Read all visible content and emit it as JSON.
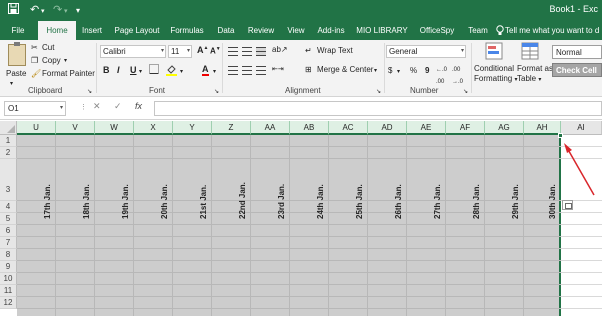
{
  "titlebar": {
    "title": "Book1 - Exc",
    "icons": [
      "save-icon",
      "undo-icon",
      "redo-icon",
      "customize-qat-icon"
    ]
  },
  "tabs": [
    {
      "label": "File",
      "active": false
    },
    {
      "label": "Home",
      "active": true
    },
    {
      "label": "Insert",
      "active": false
    },
    {
      "label": "Page Layout",
      "active": false
    },
    {
      "label": "Formulas",
      "active": false
    },
    {
      "label": "Data",
      "active": false
    },
    {
      "label": "Review",
      "active": false
    },
    {
      "label": "View",
      "active": false
    },
    {
      "label": "Add-ins",
      "active": false
    },
    {
      "label": "MIO LIBRARY",
      "active": false
    },
    {
      "label": "OfficeSpy",
      "active": false
    },
    {
      "label": "Team",
      "active": false
    }
  ],
  "tell_me": "Tell me what you want to d",
  "ribbon": {
    "clipboard": {
      "paste": "Paste",
      "cut": "Cut",
      "copy": "Copy",
      "format_painter": "Format Painter",
      "label": "Clipboard"
    },
    "font": {
      "name": "Calibri",
      "size": "11",
      "grow": "A",
      "shrink": "A",
      "bold": "B",
      "italic": "I",
      "underline": "U",
      "font_color": "A",
      "label": "Font"
    },
    "alignment": {
      "wrap_text": "Wrap Text",
      "merge_center": "Merge & Center",
      "label": "Alignment"
    },
    "number": {
      "format": "General",
      "currency": "$",
      "percent": "%",
      "comma": "9",
      "label": "Number"
    },
    "styles": {
      "conditional_formatting": [
        "Conditional",
        "Formatting"
      ],
      "format_as_table": [
        "Format as",
        "Table"
      ],
      "normal": "Normal",
      "check_cell": "Check Cell"
    }
  },
  "formula_bar": {
    "name_box": "O1",
    "cancel": "✕",
    "enter": "✓",
    "fx": "fx",
    "value": ""
  },
  "sheet": {
    "columns": [
      "U",
      "V",
      "W",
      "X",
      "Y",
      "Z",
      "AA",
      "AB",
      "AC",
      "AD",
      "AE",
      "AF",
      "AG",
      "AH",
      "AI"
    ],
    "rows": [
      "1",
      "2",
      "3",
      "4",
      "5",
      "6",
      "7",
      "8",
      "9",
      "10",
      "11",
      "12"
    ],
    "row3_dates": [
      "17th Jan.",
      "18th Jan.",
      "19th Jan.",
      "20th Jan.",
      "21st Jan.",
      "22nd Jan.",
      "23rd Jan.",
      "24th Jan.",
      "25th Jan.",
      "26th Jan.",
      "27th Jan.",
      "28th Jan.",
      "29th Jan.",
      "30th Jan."
    ],
    "selection_color": "#cdcdcd",
    "accent_color": "#217346",
    "annotation_arrow_color": "#d9262b"
  }
}
